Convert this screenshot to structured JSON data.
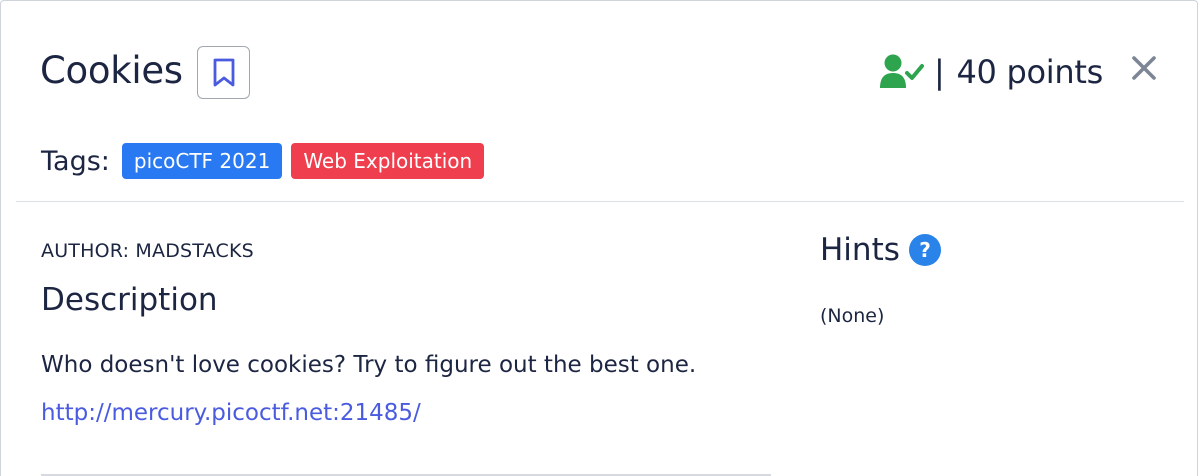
{
  "challenge": {
    "title": "Cookies",
    "points_separator": "|",
    "points": "40 points",
    "tags_label": "Tags:",
    "tags": [
      "picoCTF 2021",
      "Web Exploitation"
    ],
    "author": "AUTHOR: MADSTACKS",
    "description_heading": "Description",
    "description": "Who doesn't love cookies? Try to figure out the best one.",
    "link": "http://mercury.picoctf.net:21485/"
  },
  "hints": {
    "heading": "Hints",
    "value": "(None)"
  },
  "icons": {
    "bookmark": "bookmark-icon",
    "solved": "user-check-icon",
    "close": "close-icon",
    "help": "question-circle-icon"
  },
  "colors": {
    "tag_blue": "#2979f3",
    "tag_red": "#ef3e4e",
    "solved_green": "#2ea44f",
    "link": "#4a5be0",
    "help_blue": "#2a83e8"
  }
}
